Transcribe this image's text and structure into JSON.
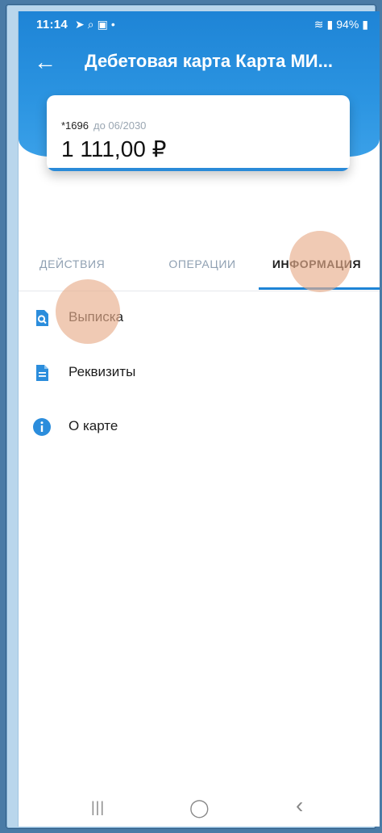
{
  "status_bar": {
    "time": "11:14",
    "battery": "94%",
    "left_icons": [
      "telegram-icon",
      "search-icon",
      "gallery-icon",
      "dot-icon"
    ],
    "right_icons": [
      "wifi-icon",
      "volte-icon",
      "signal-icon",
      "battery-icon"
    ]
  },
  "header": {
    "back_icon": "←",
    "title": "Дебетовая карта Карта МИ..."
  },
  "card": {
    "number": "*1696",
    "expiry": "до 06/2030",
    "balance": "1 111,00 ₽"
  },
  "tabs": [
    {
      "label": "ДЕЙСТВИЯ",
      "active": false
    },
    {
      "label": "ОПЕРАЦИИ",
      "active": false
    },
    {
      "label": "ИНФОРМАЦИЯ",
      "active": true
    }
  ],
  "menu": [
    {
      "label": "Выписка",
      "icon": "statement-search-icon"
    },
    {
      "label": "Реквизиты",
      "icon": "document-icon"
    },
    {
      "label": "О карте",
      "icon": "info-icon"
    }
  ],
  "nav": {
    "recent": "|||",
    "home": "◯",
    "back": "‹"
  },
  "colors": {
    "accent": "#1e84d6",
    "header_bg": "#2b94e1",
    "tab_inactive": "#8fa0b2",
    "tap_highlight": "#e8ae8c"
  }
}
